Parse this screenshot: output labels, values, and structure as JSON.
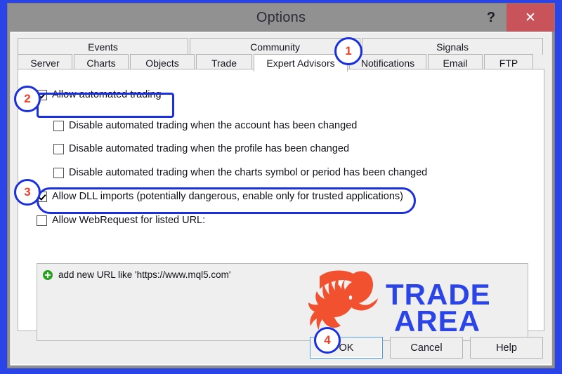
{
  "window": {
    "title": "Options",
    "help_glyph": "?",
    "close_glyph": "✕",
    "close_icon_name": "close-icon",
    "frame_color": "#2a44e8",
    "titlebar_color": "#919191",
    "close_button_color": "#c8535a"
  },
  "tabs": {
    "row1": [
      {
        "label": "Events"
      },
      {
        "label": "Community"
      },
      {
        "label": "Signals"
      }
    ],
    "row2": [
      {
        "label": "Server",
        "active": false
      },
      {
        "label": "Charts",
        "active": false
      },
      {
        "label": "Objects",
        "active": false
      },
      {
        "label": "Trade",
        "active": false
      },
      {
        "label": "Expert Advisors",
        "active": true
      },
      {
        "label": "Notifications",
        "active": false
      },
      {
        "label": "Email",
        "active": false
      },
      {
        "label": "FTP",
        "active": false
      }
    ]
  },
  "options": {
    "checkboxes": [
      {
        "label": "Allow automated trading",
        "checked": true
      },
      {
        "label": "Disable automated trading when the account has been changed",
        "checked": false
      },
      {
        "label": "Disable automated trading when the profile has been changed",
        "checked": false
      },
      {
        "label": "Disable automated trading when the charts symbol or period has been changed",
        "checked": false
      },
      {
        "label": "Allow DLL imports (potentially dangerous, enable only for trusted applications)",
        "checked": true
      },
      {
        "label": "Allow WebRequest for listed URL:",
        "checked": false
      }
    ]
  },
  "url_list": {
    "add_row_label": "add new URL like 'https://www.mql5.com'",
    "add_icon_name": "plus-circle-icon"
  },
  "logo": {
    "line1": "TRADE",
    "line2": "AREA",
    "bull_color": "#f2512f",
    "text_color": "#2a44e8"
  },
  "footer": {
    "ok_label": "OK",
    "cancel_label": "Cancel",
    "help_label": "Help"
  },
  "annotations": [
    {
      "number": "1",
      "target": "expert-advisors-tab"
    },
    {
      "number": "2",
      "target": "allow-automated-trading-checkbox"
    },
    {
      "number": "3",
      "target": "allow-dll-imports-checkbox"
    },
    {
      "number": "4",
      "target": "ok-button"
    }
  ]
}
